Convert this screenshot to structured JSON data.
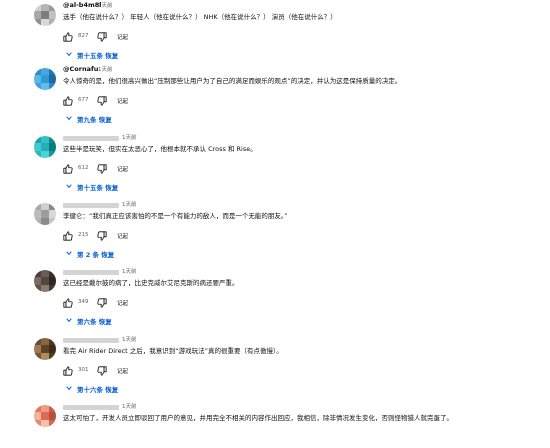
{
  "comments": [
    {
      "author": "@al-b4m8l",
      "time": "1天前",
      "show_author": true,
      "text": "选手（他在说什么？） 年轻人（他在说什么？） NHK（他在说什么？） 演员（他在说什么？）",
      "likes": "827",
      "reply_label": "记起",
      "replies_label": "第十五条 恢复",
      "avatar_colors": [
        "#cfcfcf",
        "#b5b5b5",
        "#9a9a9a",
        "#a8a8a8",
        "#7d7d7d",
        "#c2c2c2",
        "#8f8f8f",
        "#d9d9d9",
        "#b0b0b0"
      ]
    },
    {
      "author": "@Cornafu",
      "time": "1天前",
      "show_author": true,
      "text": "令人惊奇的是，他们很高兴做出“压制那些让用户为了自己的满足而娱乐的观点”的决定，并认为这是保持质量的决定。",
      "likes": "677",
      "reply_label": "记起",
      "replies_label": "第九条 恢复",
      "avatar_colors": [
        "#2b8fcf",
        "#49a7df",
        "#1f76b5",
        "#5db6e6",
        "#3298d6",
        "#1a6aa4",
        "#3f9fd9",
        "#62bbe9",
        "#2a86c4"
      ]
    },
    {
      "author": "",
      "time": "1天前",
      "show_author": false,
      "text": "这些半是玩笑，但实在太恶心了，他根本就不承认 Cross 和 Rise。",
      "likes": "612",
      "reply_label": "记起",
      "replies_label": "第十五条 恢复",
      "avatar_colors": [
        "#1aa3a8",
        "#35c0c4",
        "#0f8a8f",
        "#41cbcf",
        "#22b0b5",
        "#0a7a7e",
        "#2bb9bd",
        "#4fd2d6",
        "#14979b"
      ]
    },
    {
      "author": "",
      "time": "1天前",
      "show_author": false,
      "text": "李健仑：“我们真正应该害怕的不是一个有能力的敌人，而是一个无能的朋友。”",
      "likes": "215",
      "reply_label": "记起",
      "replies_label": "第 2 条 恢复",
      "avatar_colors": [
        "#a9a9a9",
        "#cfcfcf",
        "#8c8c8c",
        "#bdbdbd",
        "#9d9d9d",
        "#d8d8d8",
        "#b3b3b3",
        "#8a8a8a",
        "#c6c6c6"
      ]
    },
    {
      "author": "",
      "time": "1天前",
      "show_author": false,
      "text": "这已经是戴尔鼓的病了，比史克威尔艾尼克斯的病还要严重。",
      "likes": "349",
      "reply_label": "记起",
      "replies_label": "第六条 恢复",
      "avatar_colors": [
        "#4a3f3a",
        "#6b5d55",
        "#3a302c",
        "#7a6b62",
        "#54473f",
        "#2f2622",
        "#5f514a",
        "#8a7a70",
        "#43372f"
      ]
    },
    {
      "author": "",
      "time": "1天前",
      "show_author": false,
      "text": "看完 Air Rider Direct 之后，我意识到“游戏玩法”真的很重要（有点傲慢）。",
      "likes": "301",
      "reply_label": "记起",
      "replies_label": "第十六条 恢复",
      "avatar_colors": [
        "#6b4a2e",
        "#8a6440",
        "#4f361f",
        "#a07a52",
        "#5d4128",
        "#3e2a17",
        "#7a5636",
        "#b08a60",
        "#553a22"
      ]
    },
    {
      "author": "",
      "time": "1天前",
      "show_author": false,
      "text": "这太可怕了，开发人员立即驳回了用户的意见，并用完全不相关的内容作出回应，我相信，除非情况发生变化，否则怪物猎人就完蛋了。",
      "likes": "",
      "reply_label": "",
      "replies_label": "",
      "avatar_colors": [
        "#e07a5f",
        "#f09a7f",
        "#c9604a",
        "#f4b29a",
        "#d86c54",
        "#b8503c",
        "#e88a70",
        "#f8c0a8",
        "#cf6650"
      ]
    }
  ]
}
